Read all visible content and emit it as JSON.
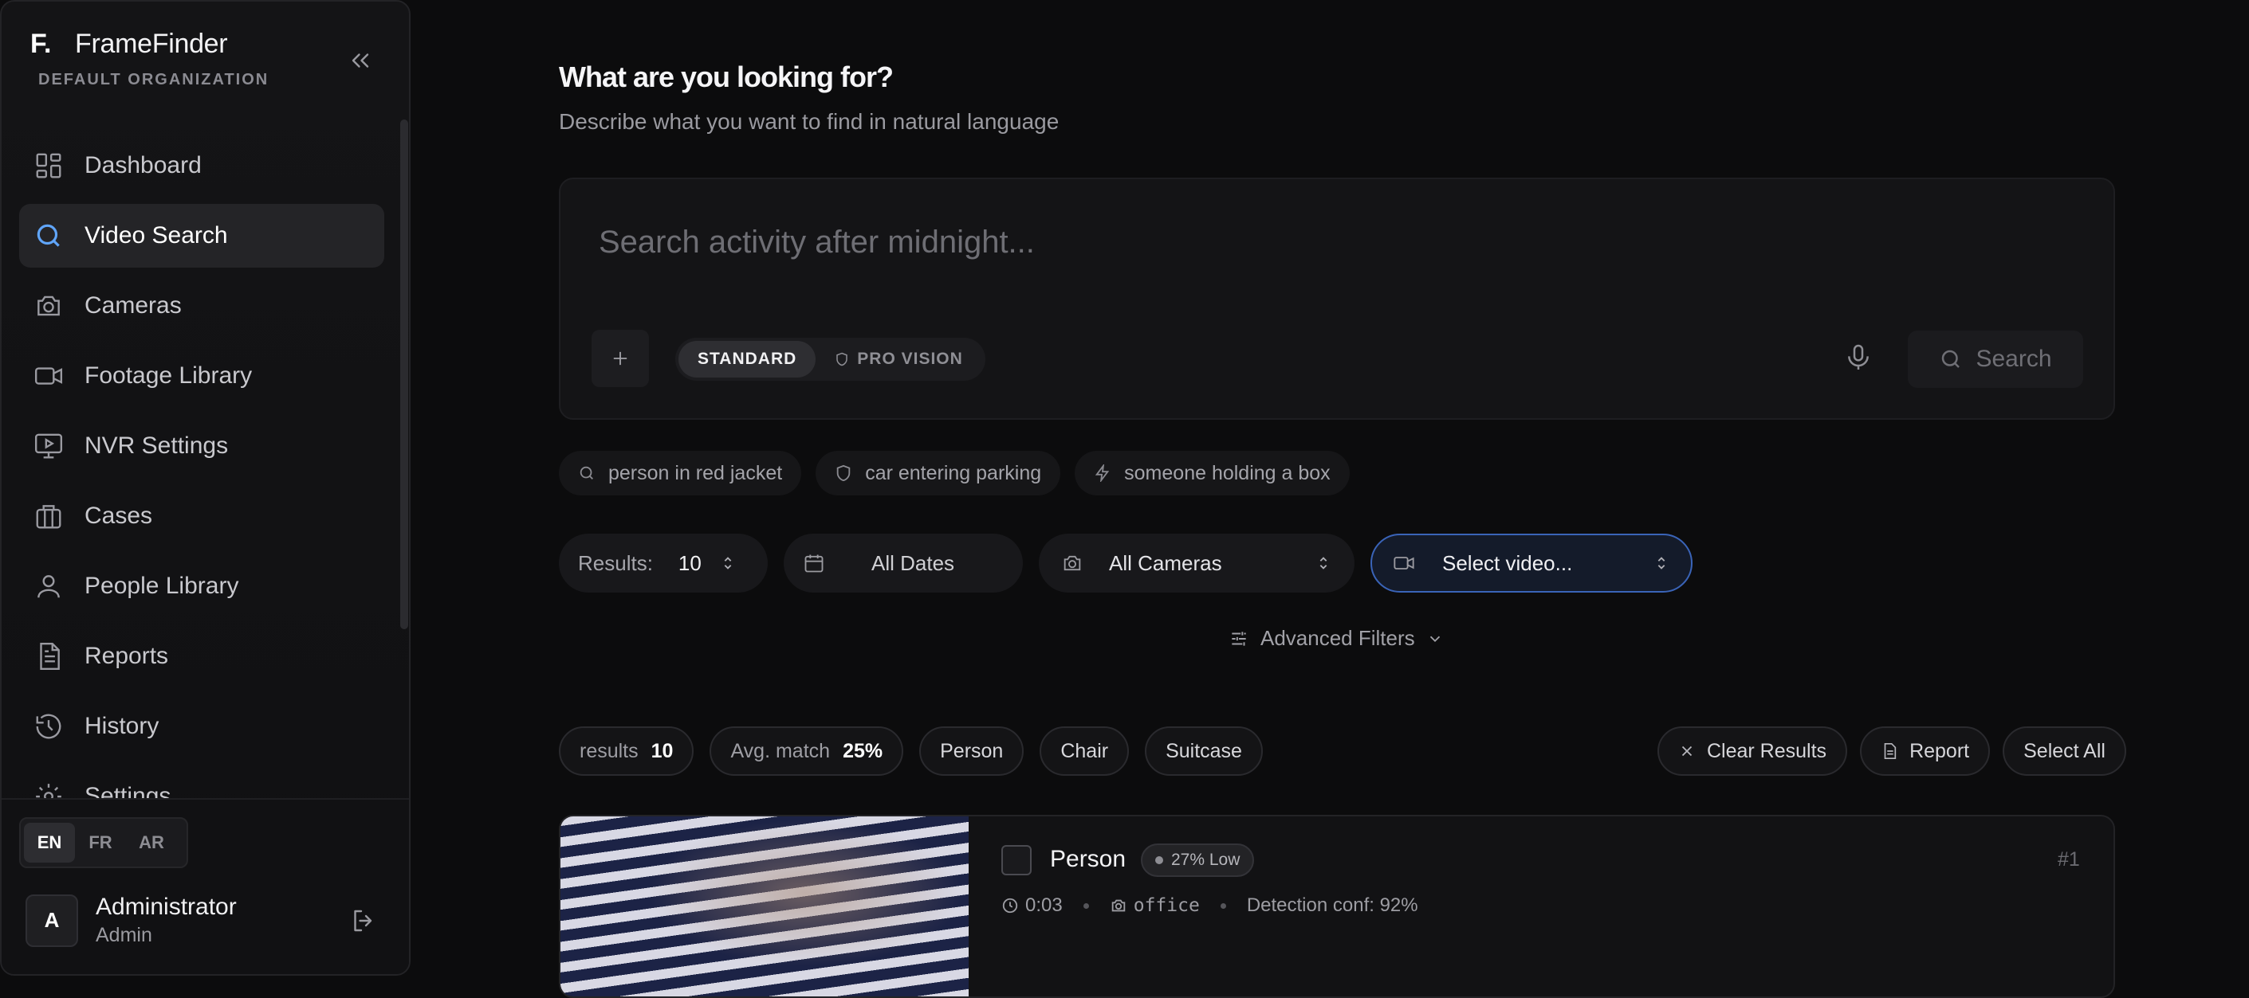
{
  "app": {
    "logo_letter": "F.",
    "name": "FrameFinder",
    "org": "DEFAULT ORGANIZATION",
    "accent": "#3b82f6"
  },
  "sidebar": {
    "items": [
      {
        "label": "Dashboard",
        "icon": "dashboard-icon"
      },
      {
        "label": "Video Search",
        "icon": "search-icon",
        "active": true
      },
      {
        "label": "Cameras",
        "icon": "camera-icon"
      },
      {
        "label": "Footage Library",
        "icon": "video-icon"
      },
      {
        "label": "NVR Settings",
        "icon": "monitor-play-icon"
      },
      {
        "label": "Cases",
        "icon": "briefcase-icon"
      },
      {
        "label": "People Library",
        "icon": "user-icon"
      },
      {
        "label": "Reports",
        "icon": "document-icon"
      },
      {
        "label": "History",
        "icon": "history-icon"
      },
      {
        "label": "Settings",
        "icon": "gear-icon"
      }
    ],
    "languages": [
      "EN",
      "FR",
      "AR"
    ],
    "selected_language": "EN",
    "user": {
      "avatar": "A",
      "name": "Administrator",
      "role": "Admin"
    }
  },
  "main": {
    "title": "What are you looking for?",
    "subtitle": "Describe what you want to find in natural language",
    "search": {
      "placeholder": "Search activity after midnight...",
      "modes": [
        "STANDARD",
        "PRO VISION"
      ],
      "active_mode": "STANDARD",
      "button": "Search"
    },
    "suggestions": [
      {
        "label": "person in red jacket",
        "icon": "search-icon"
      },
      {
        "label": "car entering parking",
        "icon": "shield-icon"
      },
      {
        "label": "someone holding a box",
        "icon": "lightning-icon"
      }
    ],
    "filters": {
      "results_label": "Results:",
      "results_value": "10",
      "dates": "All Dates",
      "cameras": "All Cameras",
      "video": "Select video..."
    },
    "advanced_filters": "Advanced Filters",
    "stats": {
      "results_label": "results",
      "results_value": "10",
      "avg_label": "Avg. match",
      "avg_value": "25%",
      "tags": [
        "Person",
        "Chair",
        "Suitcase"
      ]
    },
    "actions": {
      "clear": "Clear Results",
      "report": "Report",
      "select_all": "Select All"
    },
    "result": {
      "label": "Person",
      "confidence": "27% Low",
      "rank": "#1",
      "time": "0:03",
      "camera": "office",
      "detection": "Detection conf: 92%"
    }
  }
}
